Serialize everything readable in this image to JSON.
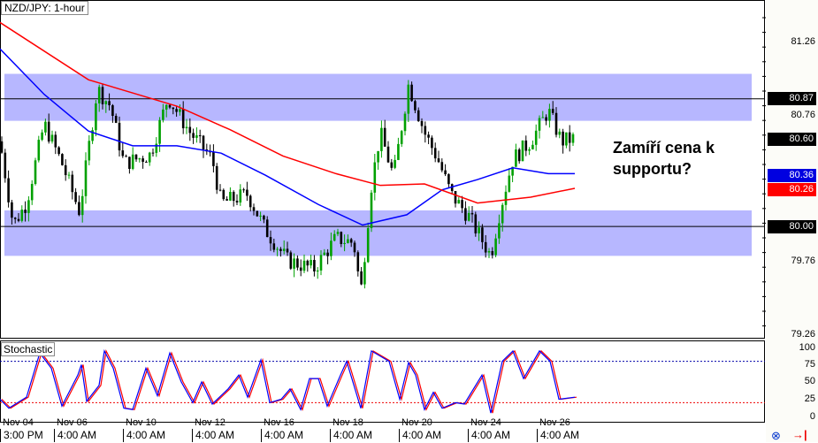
{
  "title": "NZD/JPY: 1-hour",
  "indicator_title": "Stochastic",
  "annotation": "Zamíří cena k supportu?",
  "colors": {
    "zone": "#aaaaff",
    "sma_fast": "#0000ff",
    "sma_slow": "#ff0000",
    "bull": "#00a000",
    "bear": "#000000"
  },
  "price_axis": {
    "ticks": [
      "81.26",
      "80.76",
      "79.76",
      "79.26"
    ],
    "tags": {
      "resistance": "80.87",
      "current": "80.60",
      "blue_ma": "80.36",
      "red_ma": "80.26",
      "support": "80.00"
    }
  },
  "stoch_axis": [
    "100",
    "75",
    "50",
    "25",
    "0"
  ],
  "date_labels": [
    "Nov 04",
    "Nov 06",
    "Nov 10",
    "Nov 12",
    "Nov 16",
    "Nov 18",
    "Nov 20",
    "Nov 24",
    "Nov 26"
  ],
  "time_labels": [
    "3:00 PM",
    "4:00 AM",
    "4:00 AM",
    "4:00 AM",
    "4:00 AM",
    "4:00 AM",
    "4:00 AM",
    "4:00 AM",
    "4:00 AM"
  ],
  "chart_data": {
    "type": "candlestick",
    "symbol": "NZD/JPY",
    "timeframe": "1-hour",
    "ylim": [
      79.06,
      81.55
    ],
    "resistance_zone": [
      80.72,
      81.04
    ],
    "resistance_line": 80.87,
    "support_zone": [
      79.8,
      80.11
    ],
    "support_line": 80.0,
    "price_path": [
      [
        0,
        80.58
      ],
      [
        15,
        80.01
      ],
      [
        30,
        80.16
      ],
      [
        50,
        80.7
      ],
      [
        70,
        80.43
      ],
      [
        90,
        80.1
      ],
      [
        110,
        80.94
      ],
      [
        125,
        80.82
      ],
      [
        140,
        80.43
      ],
      [
        170,
        80.49
      ],
      [
        190,
        80.88
      ],
      [
        215,
        80.64
      ],
      [
        240,
        80.46
      ],
      [
        250,
        80.16
      ],
      [
        280,
        80.22
      ],
      [
        300,
        79.98
      ],
      [
        325,
        79.77
      ],
      [
        355,
        79.71
      ],
      [
        380,
        79.92
      ],
      [
        400,
        79.89
      ],
      [
        408,
        79.55
      ],
      [
        420,
        80.28
      ],
      [
        430,
        80.64
      ],
      [
        445,
        80.34
      ],
      [
        462,
        80.97
      ],
      [
        480,
        80.64
      ],
      [
        495,
        80.46
      ],
      [
        510,
        80.22
      ],
      [
        530,
        80.07
      ],
      [
        555,
        79.8
      ],
      [
        565,
        80.1
      ],
      [
        580,
        80.46
      ],
      [
        600,
        80.58
      ],
      [
        620,
        80.79
      ],
      [
        635,
        80.58
      ],
      [
        650,
        80.6
      ]
    ],
    "ma_blue": [
      [
        0,
        81.21
      ],
      [
        50,
        80.9
      ],
      [
        100,
        80.65
      ],
      [
        150,
        80.55
      ],
      [
        200,
        80.55
      ],
      [
        250,
        80.5
      ],
      [
        300,
        80.35
      ],
      [
        360,
        80.15
      ],
      [
        410,
        80.01
      ],
      [
        460,
        80.08
      ],
      [
        500,
        80.25
      ],
      [
        540,
        80.32
      ],
      [
        580,
        80.4
      ],
      [
        620,
        80.36
      ],
      [
        650,
        80.36
      ]
    ],
    "ma_red": [
      [
        0,
        81.39
      ],
      [
        100,
        81.0
      ],
      [
        200,
        80.82
      ],
      [
        260,
        80.66
      ],
      [
        320,
        80.48
      ],
      [
        380,
        80.36
      ],
      [
        430,
        80.28
      ],
      [
        480,
        80.29
      ],
      [
        540,
        80.16
      ],
      [
        600,
        80.2
      ],
      [
        650,
        80.26
      ]
    ],
    "stochastic": {
      "levels": [
        80,
        20
      ],
      "k": [
        [
          0,
          25
        ],
        [
          10,
          12
        ],
        [
          20,
          20
        ],
        [
          30,
          28
        ],
        [
          45,
          92
        ],
        [
          58,
          70
        ],
        [
          70,
          15
        ],
        [
          88,
          60
        ],
        [
          92,
          75
        ],
        [
          98,
          22
        ],
        [
          112,
          45
        ],
        [
          118,
          95
        ],
        [
          128,
          70
        ],
        [
          140,
          12
        ],
        [
          150,
          10
        ],
        [
          165,
          70
        ],
        [
          178,
          30
        ],
        [
          192,
          92
        ],
        [
          205,
          50
        ],
        [
          218,
          20
        ],
        [
          228,
          50
        ],
        [
          240,
          18
        ],
        [
          258,
          40
        ],
        [
          270,
          60
        ],
        [
          280,
          28
        ],
        [
          295,
          82
        ],
        [
          305,
          20
        ],
        [
          318,
          25
        ],
        [
          328,
          40
        ],
        [
          340,
          10
        ],
        [
          350,
          55
        ],
        [
          360,
          55
        ],
        [
          370,
          15
        ],
        [
          385,
          60
        ],
        [
          392,
          80
        ],
        [
          408,
          12
        ],
        [
          420,
          95
        ],
        [
          440,
          80
        ],
        [
          452,
          25
        ],
        [
          462,
          78
        ],
        [
          470,
          60
        ],
        [
          480,
          10
        ],
        [
          490,
          35
        ],
        [
          500,
          12
        ],
        [
          515,
          20
        ],
        [
          525,
          18
        ],
        [
          545,
          60
        ],
        [
          555,
          5
        ],
        [
          568,
          80
        ],
        [
          580,
          95
        ],
        [
          592,
          55
        ],
        [
          610,
          95
        ],
        [
          622,
          80
        ],
        [
          632,
          25
        ],
        [
          650,
          28
        ]
      ]
    }
  }
}
